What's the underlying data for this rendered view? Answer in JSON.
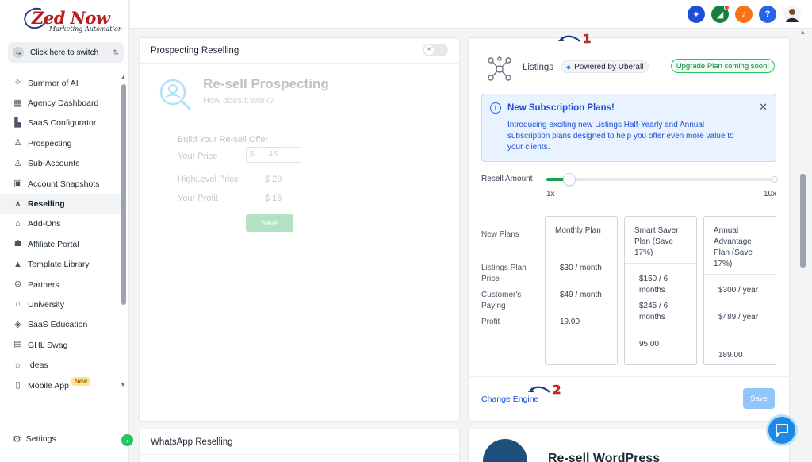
{
  "brand": {
    "logo_text": "Zed Now",
    "logo_tagline": "Marketing Automation"
  },
  "switcher": {
    "label": "Click here to switch"
  },
  "sidebar": {
    "items": [
      {
        "label": "Summer of AI",
        "icon": "sparkle-icon",
        "glyph": "✧"
      },
      {
        "label": "Agency Dashboard",
        "icon": "dashboard-icon",
        "glyph": "▦"
      },
      {
        "label": "SaaS Configurator",
        "icon": "chart-icon",
        "glyph": "▙"
      },
      {
        "label": "Prospecting",
        "icon": "user-search-icon",
        "glyph": "♙"
      },
      {
        "label": "Sub-Accounts",
        "icon": "user-icon",
        "glyph": "♙"
      },
      {
        "label": "Account Snapshots",
        "icon": "snapshot-icon",
        "glyph": "▣"
      },
      {
        "label": "Reselling",
        "icon": "network-icon",
        "glyph": "⋏",
        "active": true
      },
      {
        "label": "Add-Ons",
        "icon": "bag-icon",
        "glyph": "⌂"
      },
      {
        "label": "Affiliate Portal",
        "icon": "users-icon",
        "glyph": "☗"
      },
      {
        "label": "Template Library",
        "icon": "shapes-icon",
        "glyph": "▲"
      },
      {
        "label": "Partners",
        "icon": "handshake-icon",
        "glyph": "⊜"
      },
      {
        "label": "University",
        "icon": "graduation-icon",
        "glyph": "⌂"
      },
      {
        "label": "SaaS Education",
        "icon": "cube-icon",
        "glyph": "◈"
      },
      {
        "label": "GHL Swag",
        "icon": "store-icon",
        "glyph": "▤"
      },
      {
        "label": "Ideas",
        "icon": "bulb-icon",
        "glyph": "☼"
      },
      {
        "label": "Mobile App",
        "icon": "phone-icon",
        "glyph": "▯",
        "badge": "New"
      }
    ],
    "settings_label": "Settings",
    "collapse_glyph": "‹"
  },
  "topbar": {
    "icons": [
      {
        "name": "ticket-icon",
        "color": "#1d4ed8",
        "glyph": "✦"
      },
      {
        "name": "megaphone-icon",
        "color": "#15803d",
        "glyph": "◢"
      },
      {
        "name": "bell-icon",
        "color": "#f97316",
        "glyph": "♪"
      },
      {
        "name": "help-icon",
        "color": "#2563eb",
        "glyph": "?"
      }
    ]
  },
  "prospecting_card": {
    "header": "Prospecting Reselling",
    "title": "Re-sell Prospecting",
    "subtitle": "How does it work?",
    "build_label": "Build Your Re-sell Offer",
    "your_price_label": "Your Price",
    "currency": "$",
    "your_price_value": "45",
    "highlevel_price_label": "HighLevel Price",
    "highlevel_price_value": "$ 29",
    "your_profit_label": "Your Profit",
    "your_profit_value": "$ 16",
    "save_label": "Save"
  },
  "listings_card": {
    "title": "Listings",
    "powered_by": "Powered by Uberall",
    "upgrade_badge": "Upgrade Plan coming soon!",
    "alert": {
      "title": "New Subscription Plans!",
      "body": "Introducing exciting new Listings Half-Yearly and Annual subscription plans designed to help you offer even more value to your clients."
    },
    "resell_amount_label": "Resell Amount",
    "slider_min": "1x",
    "slider_max": "10x",
    "slider_level": 0.08,
    "row_labels": {
      "new_plans": "New Plans",
      "listings_plan_price": "Listings Plan Price",
      "customers_paying": "Customer's Paying",
      "profit": "Profit"
    },
    "plans": [
      {
        "name": "Monthly Plan",
        "price": "$30 / month",
        "paying": "$49 / month",
        "profit": "19.00"
      },
      {
        "name": "Smart Saver Plan (Save 17%)",
        "price": "$150 / 6 months",
        "paying": "$245 / 6 months",
        "profit": "95.00"
      },
      {
        "name": "Annual Advantage Plan (Save 17%)",
        "price": "$300 / year",
        "paying": "$489 / year",
        "profit": "189.00"
      }
    ],
    "change_engine_label": "Change Engine",
    "save_label": "Save"
  },
  "markers": {
    "first": "1",
    "second": "2"
  },
  "whatsapp_card": {
    "header": "WhatsApp Reselling"
  },
  "wordpress_card": {
    "title": "Re-sell WordPress"
  },
  "colors": {
    "accent_green": "#16a34a",
    "link_blue": "#1d4ed8",
    "alert_bg": "#e8f3ff"
  }
}
